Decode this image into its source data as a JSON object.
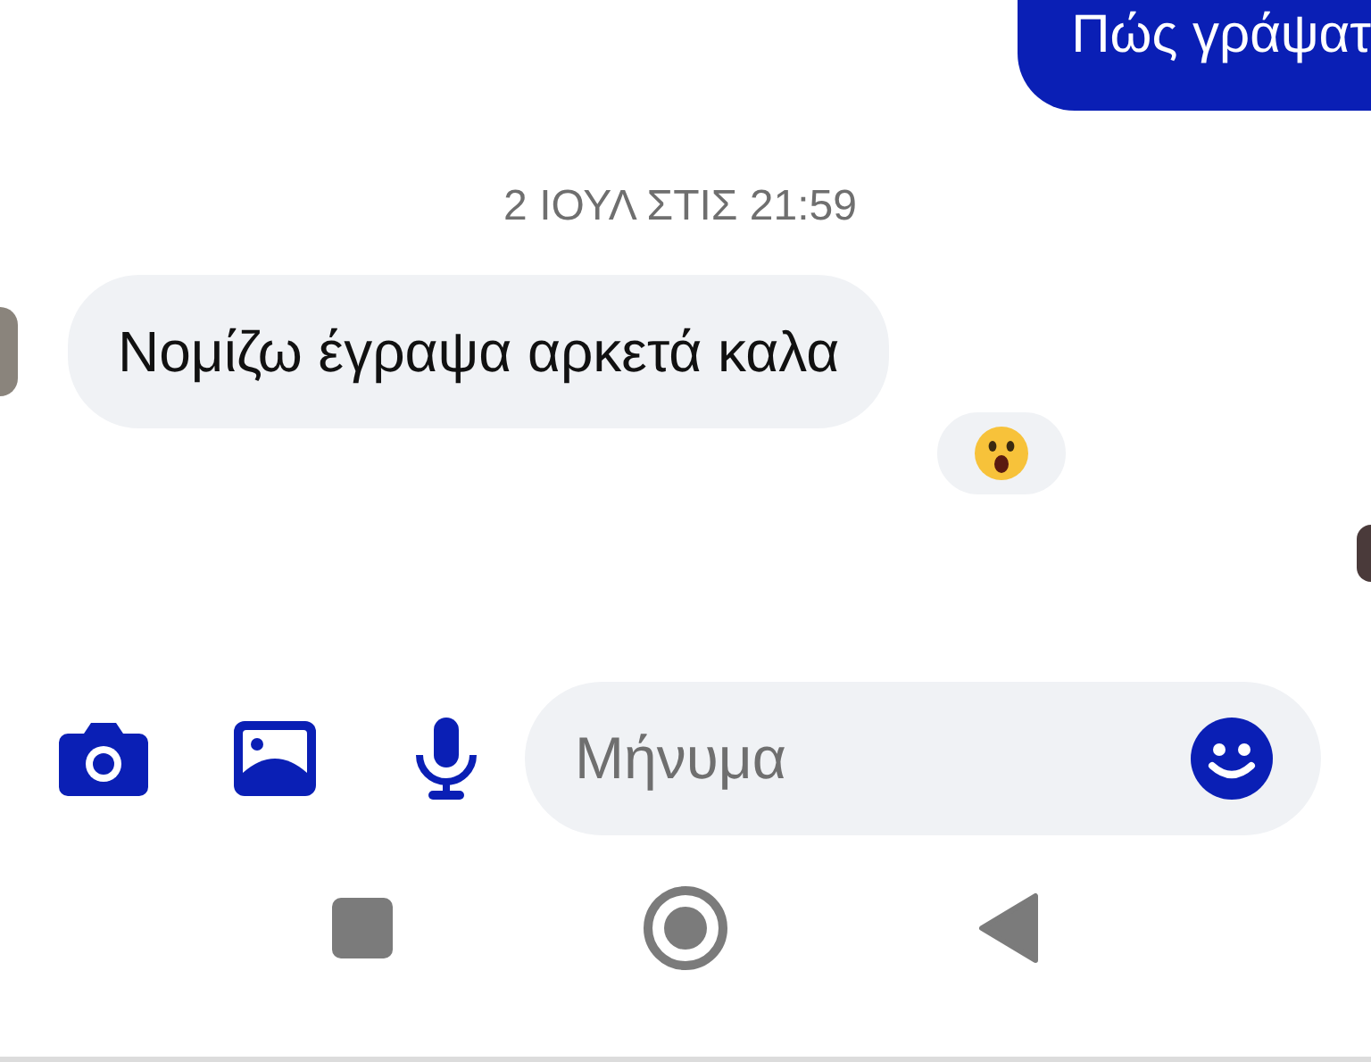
{
  "messages": [
    {
      "kind": "outgoing",
      "text": "Πώς γράψατ"
    },
    {
      "kind": "timestamp",
      "text": "2 ΙΟΥΛ ΣΤΙΣ 21:59"
    },
    {
      "kind": "incoming",
      "text": "Νομίζω έγραψα αρκετά καλα",
      "reaction": true
    }
  ],
  "composer": {
    "placeholder": "Μήνυμα"
  }
}
